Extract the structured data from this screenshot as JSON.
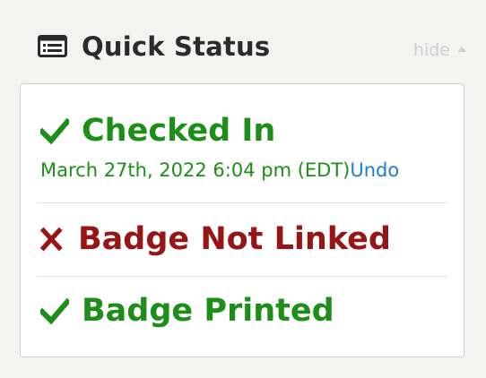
{
  "panel": {
    "title": "Quick Status",
    "hide_label": "hide",
    "header_icon": "list-window-icon"
  },
  "status_items": [
    {
      "label": "Checked In",
      "state": "ok",
      "icon": "checkmark-icon",
      "timestamp": "March 27th, 2022 6:04 pm (EDT)",
      "action_label": "Undo"
    },
    {
      "label": "Badge Not Linked",
      "state": "bad",
      "icon": "x-icon"
    },
    {
      "label": "Badge Printed",
      "state": "ok",
      "icon": "checkmark-icon"
    }
  ],
  "colors": {
    "ok": "#1d8f18",
    "bad": "#981515",
    "link": "#1e7fd1",
    "muted": "#cfcfcf",
    "title": "#2b2b2b"
  }
}
